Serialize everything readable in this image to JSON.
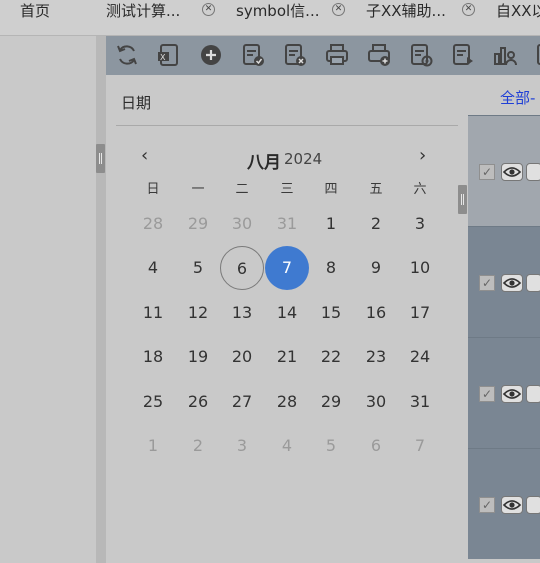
{
  "tabs": [
    {
      "label": "首页",
      "closable": false
    },
    {
      "label": "测试计算...",
      "closable": true
    },
    {
      "label": "symbol信...",
      "closable": true
    },
    {
      "label": "子XX辅助...",
      "closable": true
    },
    {
      "label": "自XX以",
      "closable": false
    }
  ],
  "toolbar": {
    "icons": [
      "refresh-icon",
      "excel-export-icon",
      "add-circle-icon",
      "document-check-icon",
      "document-cancel-icon",
      "print-icon",
      "print-add-icon",
      "document-settings-icon",
      "document-play-icon",
      "chart-user-icon",
      "document-icon"
    ]
  },
  "list_panel": {
    "filter_tab": "全部-",
    "rows": [
      {
        "checked": true
      },
      {
        "checked": true
      },
      {
        "checked": true
      },
      {
        "checked": true
      }
    ]
  },
  "date_picker": {
    "field_label": "日期",
    "month": "八月",
    "year": "2024",
    "prev_icon": "chevron-left-icon",
    "next_icon": "chevron-right-icon",
    "weekdays": [
      "日",
      "一",
      "二",
      "三",
      "四",
      "五",
      "六"
    ],
    "today": 6,
    "selected": 7,
    "weeks": [
      [
        {
          "d": "28",
          "m": true
        },
        {
          "d": "29",
          "m": true
        },
        {
          "d": "30",
          "m": true
        },
        {
          "d": "31",
          "m": true
        },
        {
          "d": "1"
        },
        {
          "d": "2"
        },
        {
          "d": "3"
        }
      ],
      [
        {
          "d": "4"
        },
        {
          "d": "5"
        },
        {
          "d": "6",
          "today": true
        },
        {
          "d": "7",
          "selected": true
        },
        {
          "d": "8"
        },
        {
          "d": "9"
        },
        {
          "d": "10"
        }
      ],
      [
        {
          "d": "11"
        },
        {
          "d": "12"
        },
        {
          "d": "13"
        },
        {
          "d": "14"
        },
        {
          "d": "15"
        },
        {
          "d": "16"
        },
        {
          "d": "17"
        }
      ],
      [
        {
          "d": "18"
        },
        {
          "d": "19"
        },
        {
          "d": "20"
        },
        {
          "d": "21"
        },
        {
          "d": "22"
        },
        {
          "d": "23"
        },
        {
          "d": "24"
        }
      ],
      [
        {
          "d": "25"
        },
        {
          "d": "26"
        },
        {
          "d": "27"
        },
        {
          "d": "28"
        },
        {
          "d": "29"
        },
        {
          "d": "30"
        },
        {
          "d": "31"
        }
      ],
      [
        {
          "d": "1",
          "m": true
        },
        {
          "d": "2",
          "m": true
        },
        {
          "d": "3",
          "m": true
        },
        {
          "d": "4",
          "m": true
        },
        {
          "d": "5",
          "m": true
        },
        {
          "d": "6",
          "m": true
        },
        {
          "d": "7",
          "m": true
        }
      ]
    ]
  },
  "colors": {
    "selected_day": "#3f7ad0",
    "toolbar": "#8c96a0",
    "filter_tab": "#1f3fd6"
  }
}
